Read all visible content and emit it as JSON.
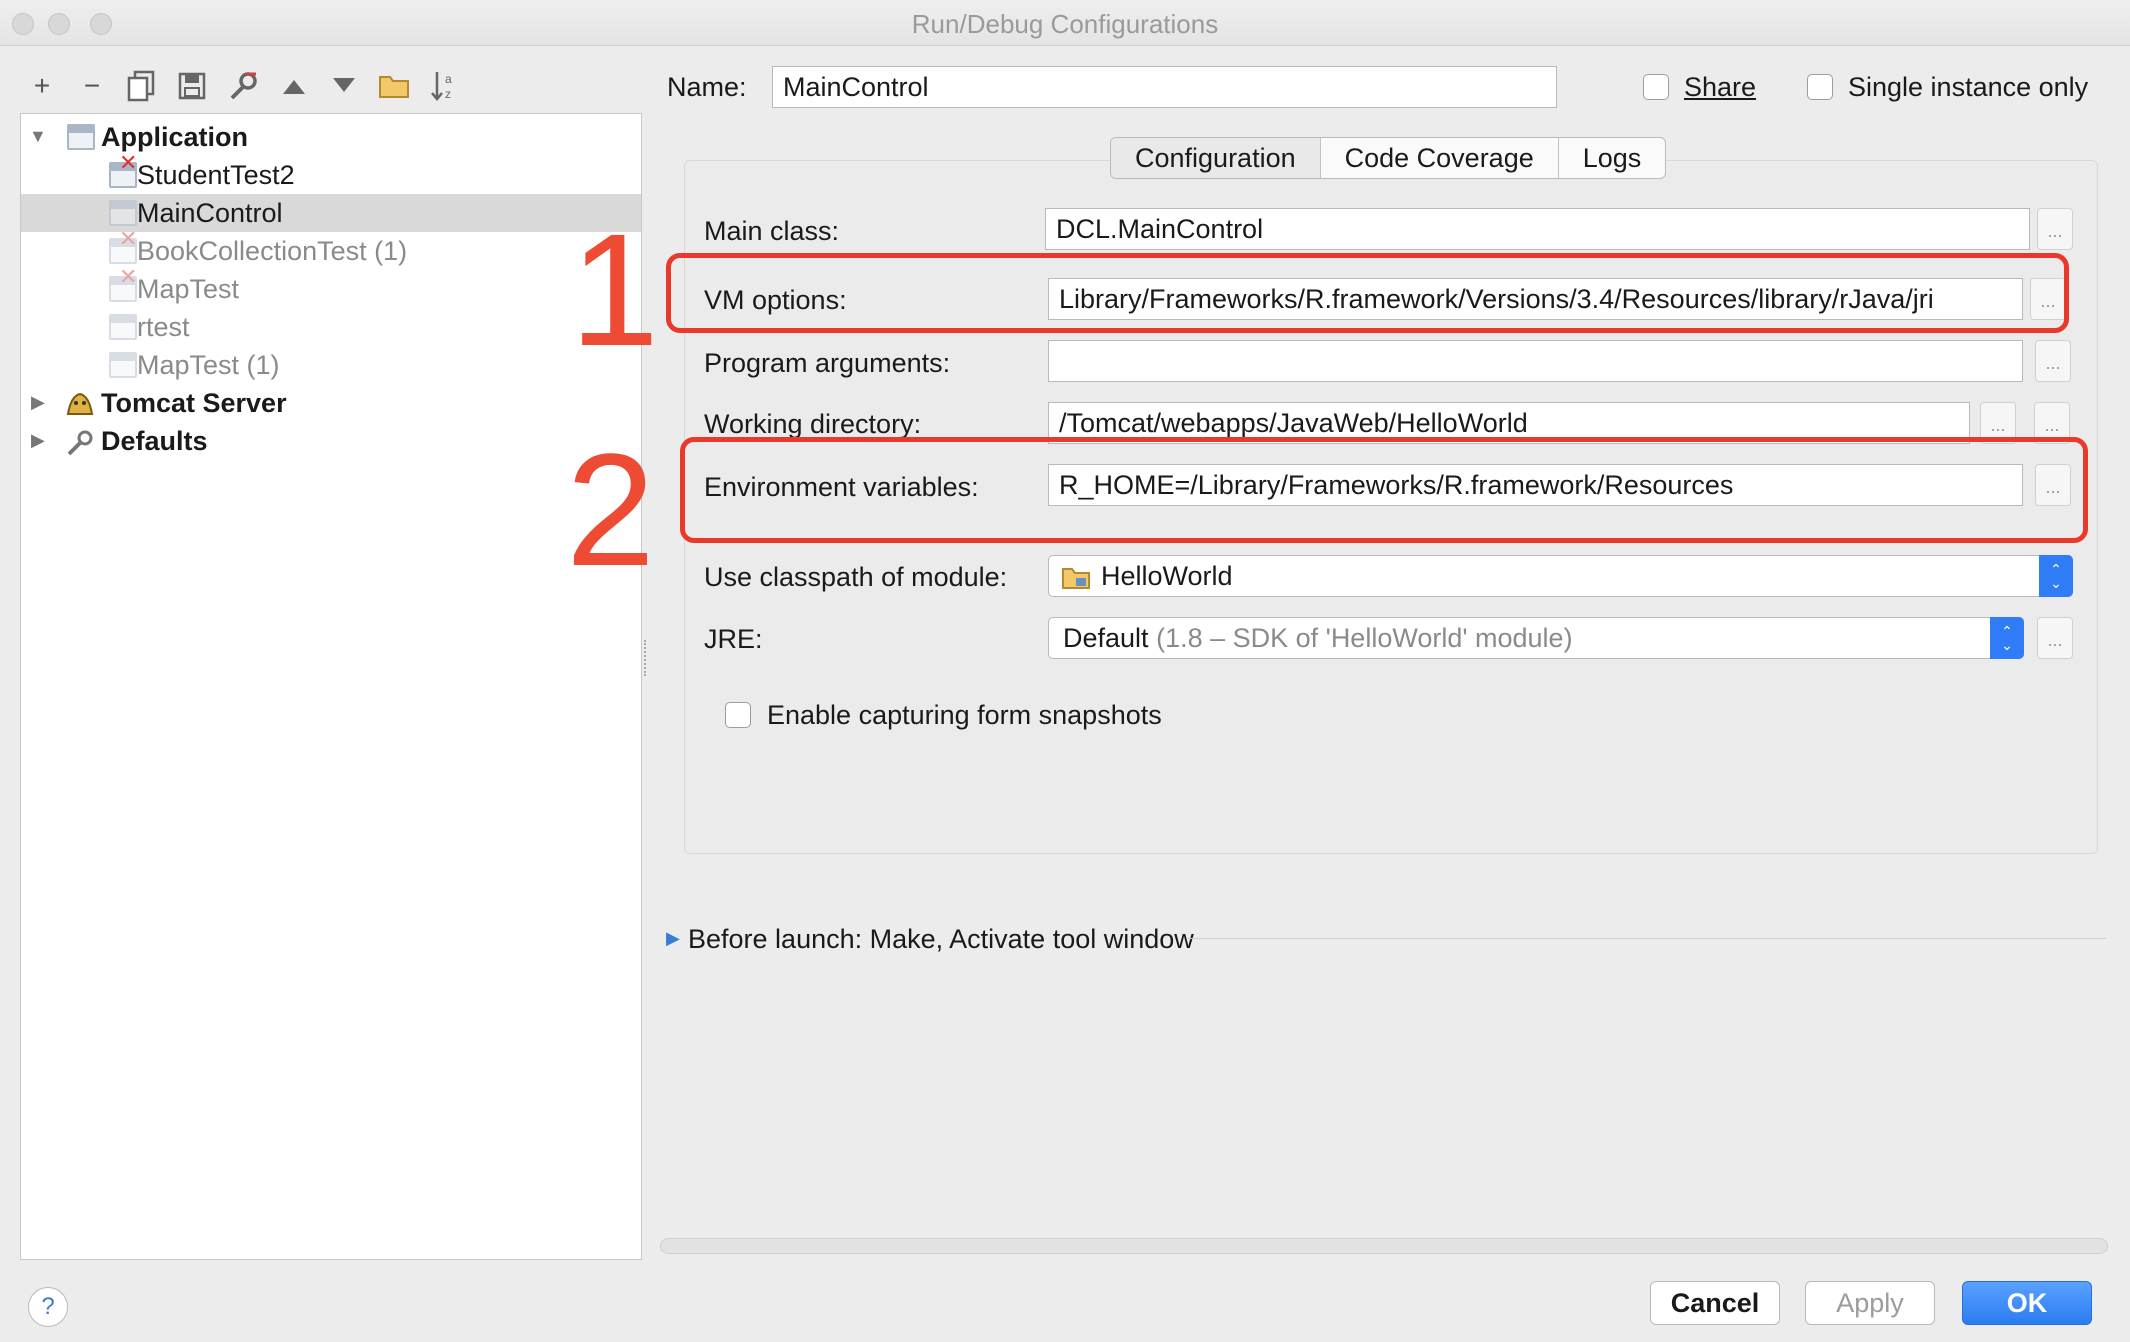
{
  "window": {
    "title": "Run/Debug Configurations"
  },
  "toolbar": {
    "icons": [
      "add-icon",
      "remove-icon",
      "copy-icon",
      "save-icon",
      "wrench-icon",
      "arrow-up-icon",
      "arrow-down-icon",
      "folder-icon",
      "sort-icon"
    ],
    "add": "+",
    "remove": "−"
  },
  "tree": {
    "application": "Application",
    "items": [
      "StudentTest2",
      "MainControl",
      "BookCollectionTest (1)",
      "MapTest",
      "rtest",
      "MapTest (1)"
    ],
    "tomcat": "Tomcat Server",
    "defaults": "Defaults"
  },
  "name": {
    "label": "Name:",
    "value": "MainControl"
  },
  "share": {
    "label": "Share"
  },
  "single_instance": {
    "label": "Single instance only"
  },
  "tabs": [
    "Configuration",
    "Code Coverage",
    "Logs"
  ],
  "form": {
    "main_class": {
      "label": "Main class:",
      "value": "DCL.MainControl"
    },
    "vm_options": {
      "label": "VM options:",
      "value": "Library/Frameworks/R.framework/Versions/3.4/Resources/library/rJava/jri"
    },
    "program_arguments": {
      "label": "Program arguments:",
      "value": ""
    },
    "working_directory": {
      "label": "Working directory:",
      "value": "/Tomcat/webapps/JavaWeb/HelloWorld"
    },
    "environment_variables": {
      "label": "Environment variables:",
      "value": "R_HOME=/Library/Frameworks/R.framework/Resources"
    },
    "classpath_module": {
      "label": "Use classpath of module:",
      "value": "HelloWorld"
    },
    "jre": {
      "label": "JRE:",
      "value": "Default",
      "hint": "(1.8 – SDK of 'HelloWorld' module)"
    },
    "snapshots": {
      "label": "Enable capturing form snapshots"
    },
    "dots": "..."
  },
  "annotations": {
    "one": "1",
    "two": "2",
    "color": "#ee4b34"
  },
  "before_launch": {
    "label": "Before launch: Make, Activate tool window"
  },
  "buttons": {
    "help": "?",
    "cancel": "Cancel",
    "apply": "Apply",
    "ok": "OK"
  },
  "colors": {
    "accent": "#2f7cf6",
    "highlight": "#e8392b"
  }
}
